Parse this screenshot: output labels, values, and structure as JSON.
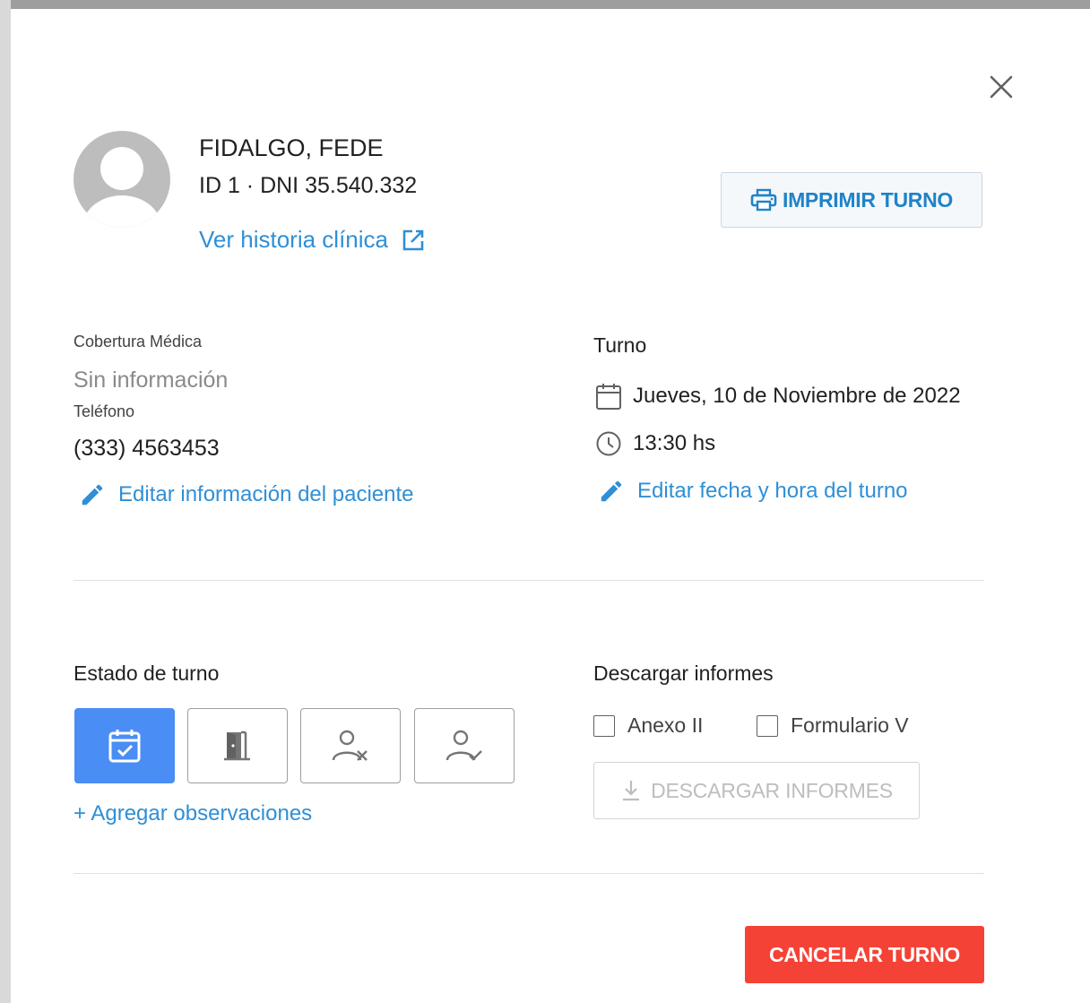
{
  "patient": {
    "name": "FIDALGO, FEDE",
    "ids": "ID 1 · DNI 35.540.332",
    "history_link": "Ver historia clínica"
  },
  "actions": {
    "print_label": "IMPRIMIR TURNO",
    "cancel_label": "CANCELAR TURNO",
    "download_label": "DESCARGAR INFORMES"
  },
  "coverage": {
    "label": "Cobertura Médica",
    "value": "Sin información"
  },
  "phone": {
    "label": "Teléfono",
    "value": "(333) 4563453"
  },
  "edit_patient_link": "Editar información del paciente",
  "appointment": {
    "title": "Turno",
    "date": "Jueves, 10 de Noviembre de 2022",
    "time": "13:30 hs",
    "edit_link": "Editar fecha y hora del turno"
  },
  "status": {
    "title": "Estado de turno",
    "buttons": [
      {
        "icon": "calendar-check-icon",
        "active": true
      },
      {
        "icon": "door-icon",
        "active": false
      },
      {
        "icon": "person-remove-icon",
        "active": false
      },
      {
        "icon": "person-check-icon",
        "active": false
      }
    ],
    "add_notes": "+ Agregar observaciones"
  },
  "reports": {
    "title": "Descargar informes",
    "options": [
      {
        "label": "Anexo II",
        "checked": false
      },
      {
        "label": "Formulario V",
        "checked": false
      }
    ]
  },
  "colors": {
    "accent": "#2f8fd6",
    "active_status": "#4a8df5",
    "danger": "#f44336"
  }
}
